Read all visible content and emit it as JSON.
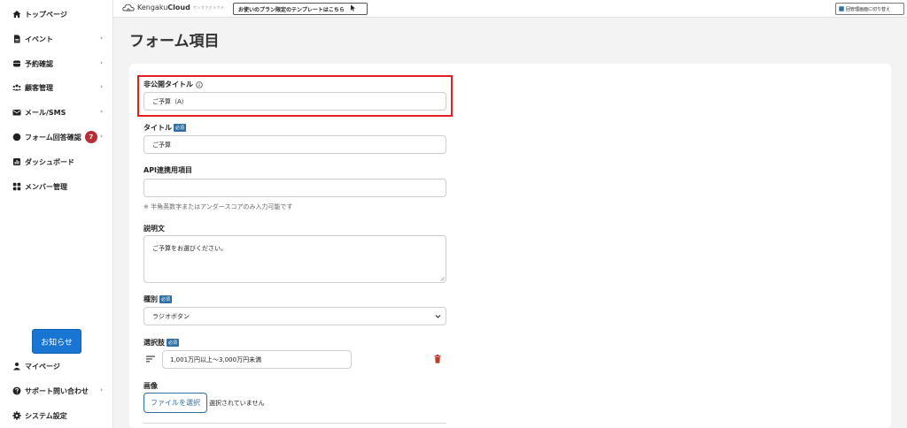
{
  "sidebar": {
    "items": [
      {
        "label": "トップページ",
        "icon": "home-icon"
      },
      {
        "label": "イベント",
        "icon": "document-icon",
        "chevron": "›"
      },
      {
        "label": "予約確認",
        "icon": "database-icon",
        "chevron": "›"
      },
      {
        "label": "顧客管理",
        "icon": "users-icon",
        "chevron": "›"
      },
      {
        "label": "メール/SMS",
        "icon": "mail-icon",
        "chevron": "›"
      },
      {
        "label": "フォーム回答確認",
        "icon": "chat-bubble-icon",
        "badge": "7",
        "chevron": "›"
      },
      {
        "label": "ダッシュボード",
        "icon": "chart-icon"
      },
      {
        "label": "メンバー管理",
        "icon": "grid-icon"
      }
    ],
    "notice_button": "お知らせ",
    "bottom_items": [
      {
        "label": "マイページ",
        "icon": "person-icon"
      },
      {
        "label": "サポート問い合わせ",
        "icon": "question-icon",
        "chevron": "›"
      },
      {
        "label": "システム設定",
        "icon": "gear-icon"
      }
    ]
  },
  "topbar": {
    "logo_light": "Kengaku",
    "logo_bold": "Cloud",
    "logo_sub": "ケンガククラウド",
    "template_button": "お使いのプラン限定のテンプレートはこちら",
    "switch_button": "回管理画面に切り替え"
  },
  "page": {
    "title": "フォーム項目"
  },
  "form": {
    "private_title": {
      "label": "非公開タイトル",
      "value": "ご予算（A）"
    },
    "title": {
      "label": "タイトル",
      "required": "必須",
      "value": "ご予算"
    },
    "api": {
      "label": "API連携用項目",
      "value": "",
      "hint": "※ 半角英数字またはアンダースコアのみ入力可能です"
    },
    "description": {
      "label": "説明文",
      "value": "ご予算をお選びください。"
    },
    "type": {
      "label": "種別",
      "required": "必須",
      "selected": "ラジオボタン"
    },
    "choices": {
      "label": "選択肢",
      "required": "必須",
      "items": [
        "1,001万円以上～3,000万円未満"
      ]
    },
    "image": {
      "label": "画像",
      "button": "ファイルを選択",
      "status": "選択されていません"
    }
  },
  "colors": {
    "accent": "#1876d2",
    "required_badge": "#2f6fa3",
    "highlight": "#e51f1f",
    "count_badge": "#b72f38",
    "delete": "#c0392b"
  }
}
